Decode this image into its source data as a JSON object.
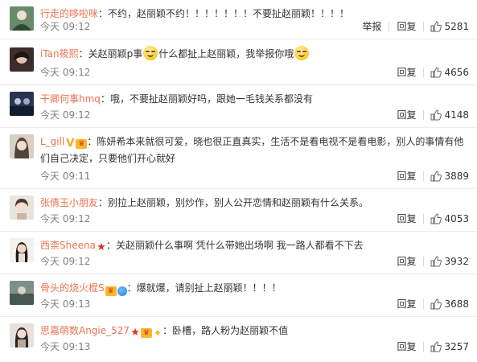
{
  "actions": {
    "report": "举报",
    "reply": "回复"
  },
  "comments": [
    {
      "user": "行走的哆啦咪",
      "badges": [],
      "text": "不约，赵丽颖不约！！！！！！！不要扯赵丽颖！！！！",
      "time": "今天 09:12",
      "likes": "5281"
    },
    {
      "user": "iTan筱熙",
      "badges": [],
      "text_before": "关赵丽颖p事",
      "text_after": "什么都扯上赵丽颖，我举报你哦",
      "time": "今天 09:12",
      "likes": "4656"
    },
    {
      "user": "干卿何事hmq",
      "badges": [],
      "text": "哦，不要扯赵丽颖好吗，跟她一毛钱关系都没有",
      "time": "今天 09:12",
      "likes": "4148"
    },
    {
      "user": "L_gill",
      "badges": [
        "verified",
        "vip"
      ],
      "text": "陈妍希本来就很可爱，晓也很正直真实，生活不是看电视不是看电影，别人的事情有他们自己决定，只要他们开心就好",
      "time": "今天 09:11",
      "likes": "3889"
    },
    {
      "user": "张倩玉小朋友",
      "badges": [],
      "text": "别拉上赵丽颖，别炒作，别人公开恋情和赵丽颖有什么关系。",
      "time": "今天 09:12",
      "likes": "4053"
    },
    {
      "user": "西柰Sheena",
      "badges": [
        "star"
      ],
      "text": "关赵丽颖什么事啊 凭什么带她出场啊 我一路人都看不下去",
      "time": "今天 09:12",
      "likes": "3932"
    },
    {
      "user": "骨头的烧火棍S",
      "badges": [
        "vip",
        "globe"
      ],
      "text": "爆就爆，请别扯上赵丽颖！！！！",
      "time": "今天 09:13",
      "likes": "3688"
    },
    {
      "user": "思嘉萌数Angie_527",
      "badges": [
        "star",
        "vip",
        "runner"
      ],
      "text": "卧槽，路人粉为赵丽颖不值",
      "time": "今天 09:13",
      "likes": "3257"
    }
  ]
}
